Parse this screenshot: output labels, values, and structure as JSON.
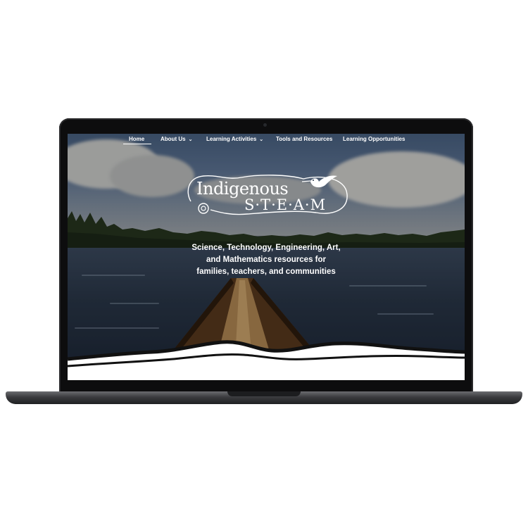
{
  "nav": {
    "items": [
      {
        "label": "Home",
        "active": true,
        "dropdown": false
      },
      {
        "label": "About Us",
        "active": false,
        "dropdown": true
      },
      {
        "label": "Learning Activities",
        "active": false,
        "dropdown": true
      },
      {
        "label": "Tools and Resources",
        "active": false,
        "dropdown": false
      },
      {
        "label": "Learning Opportunities",
        "active": false,
        "dropdown": false
      }
    ],
    "dropdown_glyph": "⌄"
  },
  "logo": {
    "line1": "Indigenous",
    "line2": "S·T·E·A·M",
    "icon": "hummingbird-icon"
  },
  "hero": {
    "tagline": [
      "Science, Technology, Engineering, Art,",
      "and Mathematics resources for",
      "families, teachers, and communities"
    ]
  },
  "colors": {
    "text": "#ffffff",
    "bezel": "#0d0d0e",
    "water": "#2a3749",
    "wave": "#ffffff"
  }
}
